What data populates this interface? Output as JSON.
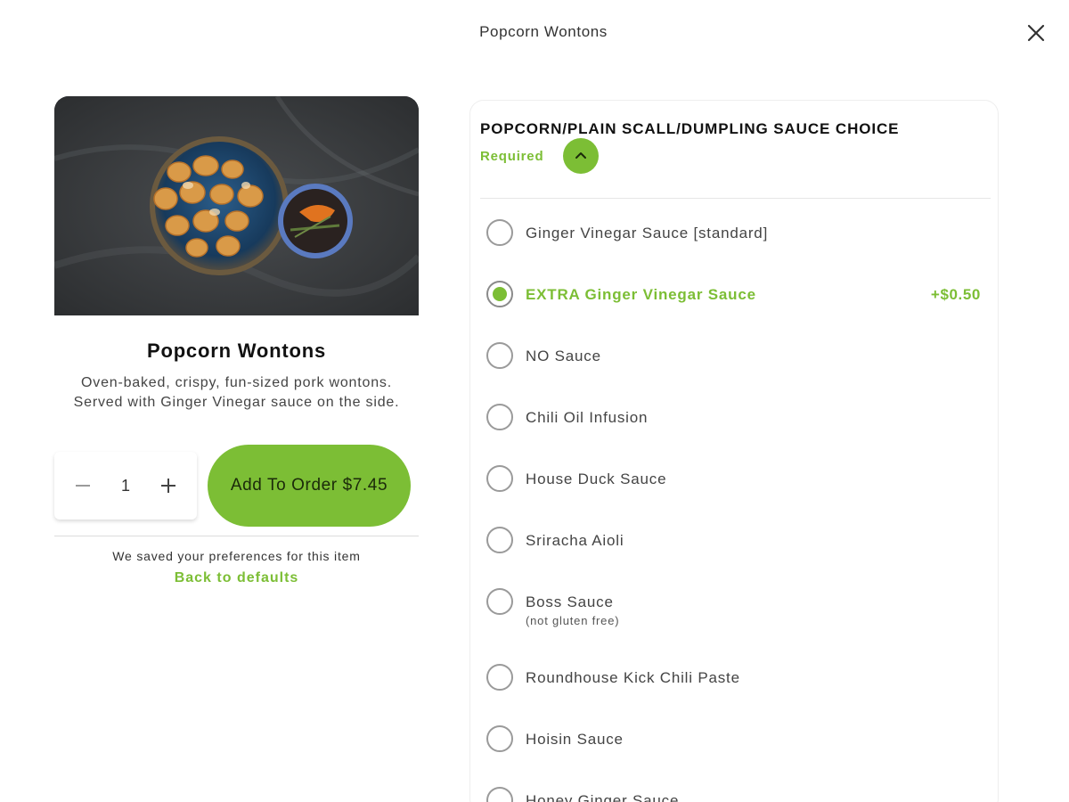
{
  "header": {
    "title": "Popcorn Wontons"
  },
  "item": {
    "name": "Popcorn Wontons",
    "description": "Oven-baked, crispy, fun-sized pork wontons. Served with Ginger Vinegar sauce on the side.",
    "quantity": "1",
    "add_button_label": "Add To Order $7.45",
    "saved_text": "We saved your preferences for this item",
    "defaults_link": "Back to defaults"
  },
  "options_group": {
    "title": "POPCORN/PLAIN SCALL/DUMPLING SAUCE CHOICE",
    "required_label": "Required",
    "options": [
      {
        "label": "Ginger Vinegar Sauce [standard]",
        "selected": false
      },
      {
        "label": "EXTRA Ginger Vinegar Sauce",
        "price": "+$0.50",
        "selected": true
      },
      {
        "label": "NO Sauce",
        "selected": false
      },
      {
        "label": "Chili Oil Infusion",
        "selected": false
      },
      {
        "label": "House Duck Sauce",
        "selected": false
      },
      {
        "label": "Sriracha Aioli",
        "selected": false
      },
      {
        "label": "Boss Sauce",
        "sublabel": "(not gluten free)",
        "selected": false
      },
      {
        "label": "Roundhouse Kick Chili Paste",
        "selected": false
      },
      {
        "label": "Hoisin Sauce",
        "selected": false
      },
      {
        "label": "Honey Ginger Sauce",
        "selected": false
      }
    ]
  },
  "colors": {
    "accent": "#7cbe35"
  },
  "icons": {
    "close": "close-icon",
    "collapse": "chevron-up-icon",
    "minus": "minus-icon",
    "plus": "plus-icon"
  }
}
